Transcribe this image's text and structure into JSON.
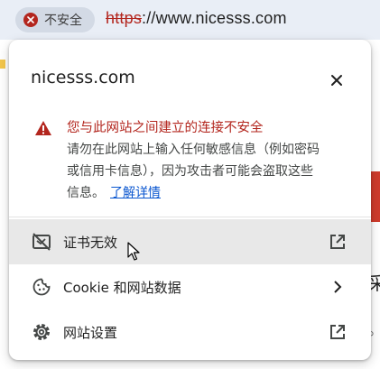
{
  "address_bar": {
    "security_chip_label": "不安全",
    "url_scheme": "https",
    "url_rest": "://www.nicesss.com"
  },
  "popup": {
    "site": "nicesss.com",
    "warning": {
      "heading": "您与此网站之间建立的连接不安全",
      "line1": "请勿在此网站上输入任何敏感信息（例如密码",
      "line2": "或信用卡信息），因为攻击者可能会盗取这些",
      "line3": "信息。",
      "learn_more": "了解详情"
    },
    "rows": {
      "certificate": "证书无效",
      "cookies": "Cookie 和网站数据",
      "site_settings": "网站设置"
    }
  },
  "background_page": {
    "glyph1": "采",
    "glyph2": "。"
  },
  "colors": {
    "danger": "#b3261e",
    "link": "#0b57d0",
    "hover_row": "#e8e8e8",
    "toolbar": "#e9eef6"
  },
  "icons": {
    "chip": "error-circle-icon",
    "close": "close-icon",
    "warning": "warning-triangle-icon",
    "certificate": "certificate-invalid-icon",
    "cookie": "cookie-icon",
    "settings": "gear-icon",
    "external": "open-in-new-icon",
    "chevron": "chevron-right-icon"
  }
}
